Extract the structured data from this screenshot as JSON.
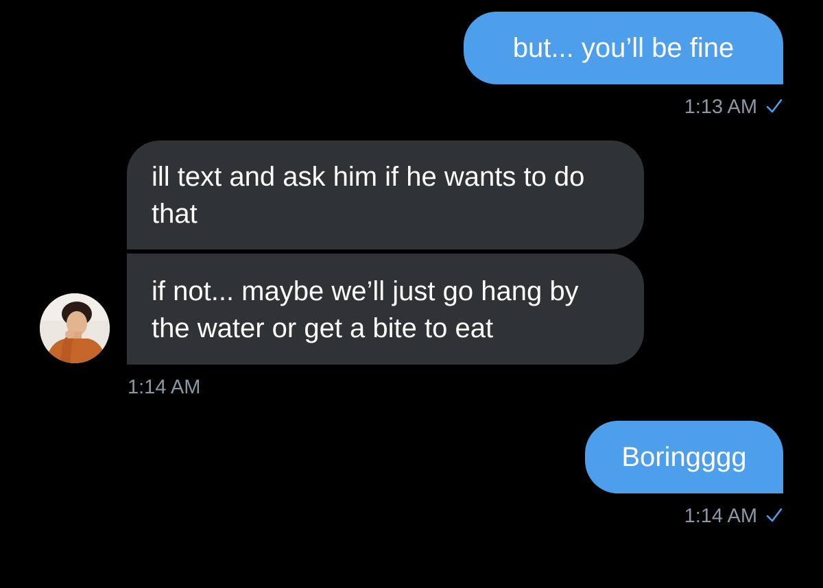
{
  "colors": {
    "background": "#000000",
    "sent_bubble": "#4d9fec",
    "received_bubble": "#2f3336",
    "timestamp": "#8b98a5",
    "check": "#4d9fec"
  },
  "messages": [
    {
      "id": "sent1",
      "direction": "sent",
      "text": "but... you’ll be fine",
      "time": "1:13 AM",
      "status_icon": "checkmark-icon"
    },
    {
      "id": "recv1",
      "direction": "received",
      "text": "ill text and ask him if he wants to do that"
    },
    {
      "id": "recv2",
      "direction": "received",
      "text": "if not... maybe we’ll just go hang by the water or get a bite to eat",
      "time": "1:14 AM",
      "avatar_icon": "contact-avatar"
    },
    {
      "id": "sent2",
      "direction": "sent",
      "text": "Boringggg",
      "time": "1:14 AM",
      "status_icon": "checkmark-icon"
    }
  ]
}
